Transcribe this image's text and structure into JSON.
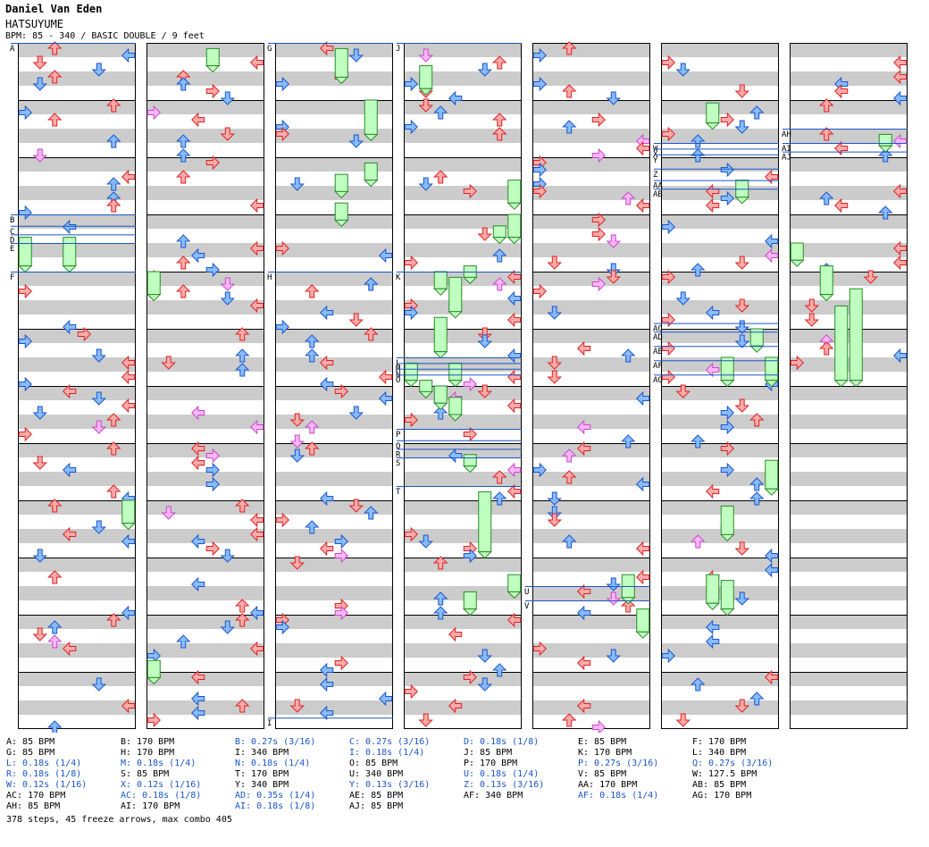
{
  "header": {
    "artist": "Daniel Van Eden",
    "song": "HATSUYUME",
    "meta": "BPM: 85 - 340 / BASIC DOUBLE / 9 feet"
  },
  "colors": {
    "band": "#cccccc",
    "red_arrow": "#ffaaaa",
    "red_stroke": "#d22",
    "blue_arrow": "#88bbff",
    "blue_stroke": "#1a56c8",
    "pink_arrow": "#ffb6ff",
    "pink_stroke": "#c64ac6",
    "freeze": "#bfffbf",
    "freeze_stroke": "#2a8a2a",
    "marker_line": "#1a56c8"
  },
  "icons": [
    "left-arrow-icon",
    "down-arrow-icon",
    "up-arrow-icon",
    "right-arrow-icon",
    "freeze-arrow-icon"
  ],
  "chart_data": {
    "type": "stepchart",
    "columns": 7,
    "measures_per_column": 12,
    "lanes": 8,
    "markers": [
      {
        "col": 0,
        "m": 0,
        "labels": [
          "A"
        ]
      },
      {
        "col": 0,
        "m": 3.0,
        "labels": [
          "B"
        ]
      },
      {
        "col": 0,
        "m": 3.2,
        "labels": [
          "C"
        ]
      },
      {
        "col": 0,
        "m": 3.35,
        "labels": [
          "D"
        ]
      },
      {
        "col": 0,
        "m": 3.5,
        "labels": [
          "E"
        ]
      },
      {
        "col": 0,
        "m": 4.0,
        "labels": [
          "F"
        ]
      },
      {
        "col": 2,
        "m": 0,
        "labels": [
          "G"
        ]
      },
      {
        "col": 2,
        "m": 4.0,
        "labels": [
          "H"
        ]
      },
      {
        "col": 2,
        "m": 11.8,
        "labels": [
          "I"
        ]
      },
      {
        "col": 3,
        "m": 0,
        "labels": [
          "J"
        ]
      },
      {
        "col": 3,
        "m": 4.0,
        "labels": [
          "K"
        ]
      },
      {
        "col": 3,
        "m": 5.5,
        "labels": [
          "L"
        ]
      },
      {
        "col": 3,
        "m": 5.6,
        "labels": [
          "M"
        ]
      },
      {
        "col": 3,
        "m": 5.7,
        "labels": [
          "N"
        ]
      },
      {
        "col": 3,
        "m": 5.8,
        "labels": [
          "O"
        ]
      },
      {
        "col": 3,
        "m": 6.75,
        "labels": [
          "P"
        ]
      },
      {
        "col": 3,
        "m": 6.95,
        "labels": [
          "Q"
        ]
      },
      {
        "col": 3,
        "m": 7.1,
        "labels": [
          "R"
        ]
      },
      {
        "col": 3,
        "m": 7.25,
        "labels": [
          "S"
        ]
      },
      {
        "col": 3,
        "m": 7.75,
        "labels": [
          "T"
        ]
      },
      {
        "col": 4,
        "m": 9.5,
        "labels": [
          "U"
        ]
      },
      {
        "col": 4,
        "m": 9.75,
        "labels": [
          "V"
        ]
      },
      {
        "col": 5,
        "m": 1.75,
        "labels": [
          "W"
        ]
      },
      {
        "col": 5,
        "m": 1.85,
        "labels": [
          "X"
        ]
      },
      {
        "col": 5,
        "m": 1.95,
        "labels": [
          "Y"
        ]
      },
      {
        "col": 5,
        "m": 2.2,
        "labels": [
          "Z"
        ]
      },
      {
        "col": 5,
        "m": 2.4,
        "labels": [
          "AA"
        ]
      },
      {
        "col": 5,
        "m": 2.55,
        "labels": [
          "AB"
        ]
      },
      {
        "col": 5,
        "m": 4.9,
        "labels": [
          "AC"
        ]
      },
      {
        "col": 5,
        "m": 5.05,
        "labels": [
          "AD"
        ]
      },
      {
        "col": 5,
        "m": 5.3,
        "labels": [
          "AE"
        ]
      },
      {
        "col": 5,
        "m": 5.55,
        "labels": [
          "AF"
        ]
      },
      {
        "col": 5,
        "m": 5.8,
        "labels": [
          "AG"
        ]
      },
      {
        "col": 6,
        "m": 1.5,
        "labels": [
          "AH"
        ]
      },
      {
        "col": 6,
        "m": 1.75,
        "labels": [
          "AI"
        ]
      },
      {
        "col": 6,
        "m": 1.9,
        "labels": [
          "AJ"
        ]
      }
    ],
    "freezes": [
      {
        "col": 0,
        "lane": 0,
        "from": 3.4,
        "to": 3.9
      },
      {
        "col": 0,
        "lane": 3,
        "from": 3.4,
        "to": 3.9
      },
      {
        "col": 0,
        "lane": 7,
        "from": 8.0,
        "to": 8.4
      },
      {
        "col": 1,
        "lane": 4,
        "from": 0.1,
        "to": 0.4
      },
      {
        "col": 1,
        "lane": 0,
        "from": 4.0,
        "to": 4.4
      },
      {
        "col": 1,
        "lane": 0,
        "from": 10.8,
        "to": 11.1
      },
      {
        "col": 2,
        "lane": 4,
        "from": 0.1,
        "to": 0.6
      },
      {
        "col": 2,
        "lane": 6,
        "from": 1.0,
        "to": 1.6
      },
      {
        "col": 2,
        "lane": 6,
        "from": 2.1,
        "to": 2.4
      },
      {
        "col": 2,
        "lane": 4,
        "from": 2.3,
        "to": 2.6
      },
      {
        "col": 2,
        "lane": 4,
        "from": 2.8,
        "to": 3.1
      },
      {
        "col": 3,
        "lane": 1,
        "from": 0.4,
        "to": 0.8
      },
      {
        "col": 3,
        "lane": 7,
        "from": 2.4,
        "to": 2.8
      },
      {
        "col": 3,
        "lane": 7,
        "from": 3.0,
        "to": 3.4
      },
      {
        "col": 3,
        "lane": 6,
        "from": 3.2,
        "to": 3.4
      },
      {
        "col": 3,
        "lane": 4,
        "from": 3.9,
        "to": 4.1
      },
      {
        "col": 3,
        "lane": 2,
        "from": 4.0,
        "to": 4.3
      },
      {
        "col": 3,
        "lane": 3,
        "from": 4.1,
        "to": 4.7
      },
      {
        "col": 3,
        "lane": 2,
        "from": 4.8,
        "to": 5.4
      },
      {
        "col": 3,
        "lane": 0,
        "from": 5.6,
        "to": 5.9
      },
      {
        "col": 3,
        "lane": 3,
        "from": 5.6,
        "to": 5.9
      },
      {
        "col": 3,
        "lane": 1,
        "from": 5.9,
        "to": 6.1
      },
      {
        "col": 3,
        "lane": 2,
        "from": 6.0,
        "to": 6.3
      },
      {
        "col": 3,
        "lane": 3,
        "from": 6.2,
        "to": 6.5
      },
      {
        "col": 3,
        "lane": 4,
        "from": 7.2,
        "to": 7.4
      },
      {
        "col": 3,
        "lane": 5,
        "from": 7.85,
        "to": 8.9
      },
      {
        "col": 3,
        "lane": 4,
        "from": 9.6,
        "to": 9.9
      },
      {
        "col": 3,
        "lane": 7,
        "from": 9.3,
        "to": 9.6
      },
      {
        "col": 4,
        "lane": 6,
        "from": 9.3,
        "to": 9.7
      },
      {
        "col": 4,
        "lane": 7,
        "from": 9.9,
        "to": 10.3
      },
      {
        "col": 5,
        "lane": 3,
        "from": 1.05,
        "to": 1.4
      },
      {
        "col": 5,
        "lane": 5,
        "from": 2.4,
        "to": 2.7
      },
      {
        "col": 5,
        "lane": 6,
        "from": 5.0,
        "to": 5.3
      },
      {
        "col": 5,
        "lane": 4,
        "from": 5.5,
        "to": 5.9
      },
      {
        "col": 5,
        "lane": 7,
        "from": 5.5,
        "to": 5.9
      },
      {
        "col": 5,
        "lane": 7,
        "from": 7.3,
        "to": 7.8
      },
      {
        "col": 5,
        "lane": 4,
        "from": 8.1,
        "to": 8.6
      },
      {
        "col": 5,
        "lane": 3,
        "from": 9.3,
        "to": 9.8
      },
      {
        "col": 5,
        "lane": 4,
        "from": 9.4,
        "to": 9.9
      },
      {
        "col": 6,
        "lane": 6,
        "from": 1.6,
        "to": 1.8
      },
      {
        "col": 6,
        "lane": 0,
        "from": 3.5,
        "to": 3.8
      },
      {
        "col": 6,
        "lane": 2,
        "from": 3.9,
        "to": 4.4
      },
      {
        "col": 6,
        "lane": 3,
        "from": 4.6,
        "to": 5.9
      },
      {
        "col": 6,
        "lane": 4,
        "from": 4.3,
        "to": 5.9
      }
    ],
    "legend": [
      {
        "text": "A: 85 BPM",
        "stop": false
      },
      {
        "text": "B: 170 BPM",
        "stop": false
      },
      {
        "text": "B: 0.27s (3/16)",
        "stop": true
      },
      {
        "text": "C: 0.27s (3/16)",
        "stop": true
      },
      {
        "text": "D: 0.18s (1/8)",
        "stop": true
      },
      {
        "text": "E: 85 BPM",
        "stop": false
      },
      {
        "text": "F: 170 BPM",
        "stop": false
      },
      {
        "text": "G: 85 BPM",
        "stop": false
      },
      {
        "text": "H: 170 BPM",
        "stop": false
      },
      {
        "text": "I: 340 BPM",
        "stop": false
      },
      {
        "text": "I: 0.18s (1/4)",
        "stop": true
      },
      {
        "text": "J: 85 BPM",
        "stop": false
      },
      {
        "text": "K: 170 BPM",
        "stop": false
      },
      {
        "text": "L: 340 BPM",
        "stop": false
      },
      {
        "text": "L: 0.18s (1/4)",
        "stop": true
      },
      {
        "text": "M: 0.18s (1/4)",
        "stop": true
      },
      {
        "text": "N: 0.18s (1/4)",
        "stop": true
      },
      {
        "text": "O: 85 BPM",
        "stop": false
      },
      {
        "text": "P: 170 BPM",
        "stop": false
      },
      {
        "text": "P: 0.27s (3/16)",
        "stop": true
      },
      {
        "text": "Q: 0.27s (3/16)",
        "stop": true
      },
      {
        "text": "R: 0.18s (1/8)",
        "stop": true
      },
      {
        "text": "S: 85 BPM",
        "stop": false
      },
      {
        "text": "T: 170 BPM",
        "stop": false
      },
      {
        "text": "U: 340 BPM",
        "stop": false
      },
      {
        "text": "U: 0.18s (1/4)",
        "stop": true
      },
      {
        "text": "V: 85 BPM",
        "stop": false
      },
      {
        "text": "W: 127.5 BPM",
        "stop": false
      },
      {
        "text": "W: 0.12s (1/16)",
        "stop": true
      },
      {
        "text": "X: 0.12s (1/16)",
        "stop": true
      },
      {
        "text": "Y: 340 BPM",
        "stop": false
      },
      {
        "text": "Y: 0.13s (3/16)",
        "stop": true
      },
      {
        "text": "Z: 0.13s (3/16)",
        "stop": true
      },
      {
        "text": "AA: 170 BPM",
        "stop": false
      },
      {
        "text": "AB: 85 BPM",
        "stop": false
      },
      {
        "text": "AC: 170 BPM",
        "stop": false
      },
      {
        "text": "AC: 0.18s (1/8)",
        "stop": true
      },
      {
        "text": "AD: 0.35s (1/4)",
        "stop": true
      },
      {
        "text": "AE: 85 BPM",
        "stop": false
      },
      {
        "text": "AF: 340 BPM",
        "stop": false
      },
      {
        "text": "AF: 0.18s (1/4)",
        "stop": true
      },
      {
        "text": "AG: 170 BPM",
        "stop": false
      },
      {
        "text": "AH: 85 BPM",
        "stop": false
      },
      {
        "text": "AI: 170 BPM",
        "stop": false
      },
      {
        "text": "AI: 0.18s (1/8)",
        "stop": true
      },
      {
        "text": "AJ: 85 BPM",
        "stop": false
      }
    ],
    "summary": "378 steps, 45 freeze arrows, max combo 405"
  }
}
